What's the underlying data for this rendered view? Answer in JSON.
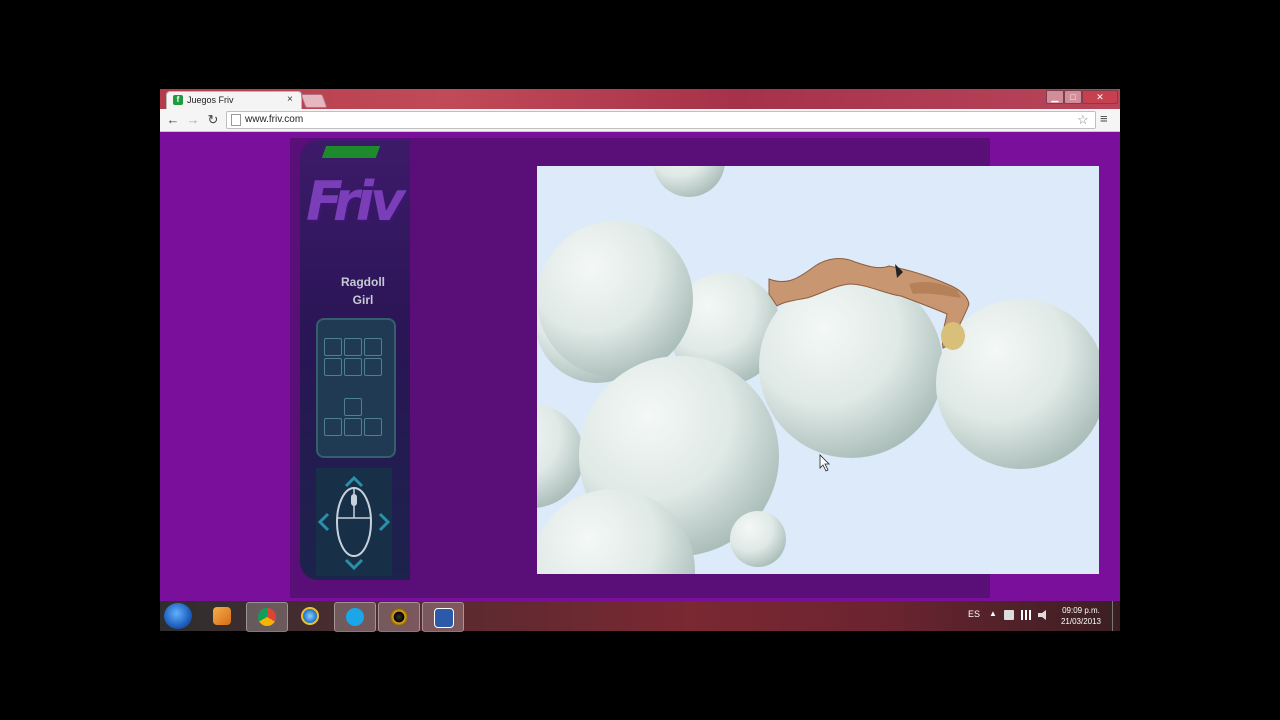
{
  "browser": {
    "tab_title": "Juegos Friv",
    "tab_close": "×",
    "url": "www.friv.com",
    "favicon": "friv-favicon",
    "window_controls": {
      "minimize": "▁",
      "maximize": "□",
      "close": "✕"
    },
    "nav": {
      "back": "←",
      "forward": "→",
      "reload": "↻",
      "star": "☆",
      "menu": "≡"
    }
  },
  "page": {
    "logo": "Friv",
    "game_title_line1": "Ragdoll",
    "game_title_line2": "Girl",
    "background_color": "#7a0f9c",
    "canvas_color": "#ddeaf9"
  },
  "taskbar": {
    "items": [
      {
        "icon": "start-orb-icon"
      },
      {
        "icon": "media-player-icon"
      },
      {
        "icon": "chrome-icon"
      },
      {
        "icon": "internet-explorer-icon"
      },
      {
        "icon": "skype-icon"
      },
      {
        "icon": "audio-app-icon"
      },
      {
        "icon": "word-icon"
      }
    ],
    "tray_lang": "ES",
    "tray_arrow": "▲",
    "clock_time": "09:09 p.m.",
    "clock_date": "21/03/2013"
  }
}
